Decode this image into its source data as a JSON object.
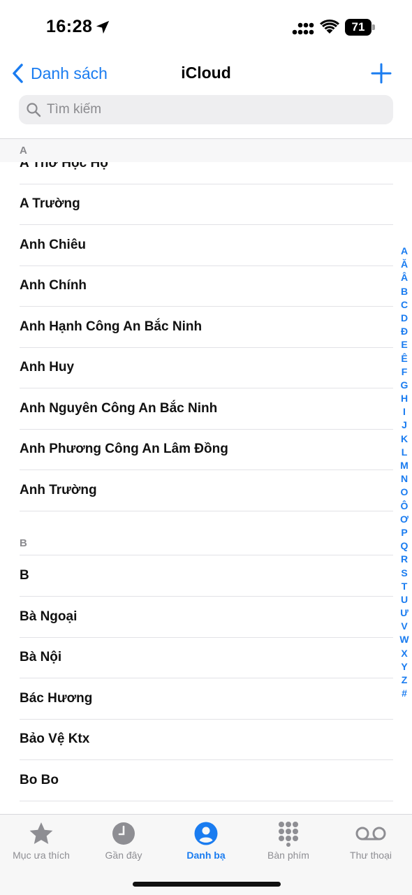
{
  "status": {
    "time": "16:28",
    "battery": "71"
  },
  "nav": {
    "back_label": "Danh sách",
    "title": "iCloud"
  },
  "search": {
    "placeholder": "Tìm kiếm"
  },
  "sections": [
    {
      "letter": "A",
      "contacts": [
        "A Thơ Học Hộ",
        "A Trường",
        "Anh Chiêu",
        "Anh Chính",
        "Anh Hạnh Công An Bắc Ninh",
        "Anh Huy",
        "Anh Nguyên Công An Bắc Ninh",
        "Anh Phương Công An Lâm Đồng",
        "Anh Trường"
      ]
    },
    {
      "letter": "B",
      "contacts": [
        "B",
        "Bà Ngoại",
        "Bà Nội",
        "Bác Hương",
        "Bảo Vệ Ktx",
        "Bo Bo"
      ]
    }
  ],
  "index": [
    "A",
    "Ă",
    "Â",
    "B",
    "C",
    "D",
    "Đ",
    "E",
    "Ê",
    "F",
    "G",
    "H",
    "I",
    "J",
    "K",
    "L",
    "M",
    "N",
    "O",
    "Ô",
    "Ơ",
    "P",
    "Q",
    "R",
    "S",
    "T",
    "U",
    "Ư",
    "V",
    "W",
    "X",
    "Y",
    "Z",
    "#"
  ],
  "tabs": [
    {
      "label": "Mục ưa thích",
      "icon": "star-icon"
    },
    {
      "label": "Gần đây",
      "icon": "clock-icon"
    },
    {
      "label": "Danh bạ",
      "icon": "person-circle-icon",
      "active": true
    },
    {
      "label": "Bàn phím",
      "icon": "keypad-icon"
    },
    {
      "label": "Thư thoại",
      "icon": "voicemail-icon"
    }
  ],
  "colors": {
    "accent": "#1a7cf0",
    "inactive": "#8e8e93"
  }
}
